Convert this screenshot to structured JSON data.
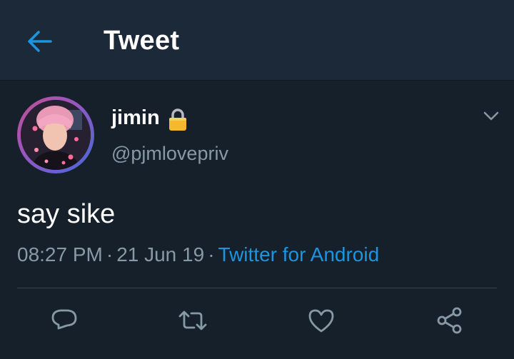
{
  "header": {
    "title": "Tweet",
    "back_icon": "arrow-left-icon"
  },
  "tweet": {
    "author": {
      "display_name": "jimin",
      "handle": "@pjmlovepriv",
      "protected_icon": "lock-icon"
    },
    "text": "say sike",
    "time": "08:27 PM",
    "date": "21 Jun 19",
    "separator": "·",
    "source": "Twitter for Android",
    "menu_icon": "chevron-down-icon",
    "actions": [
      "reply-icon",
      "retweet-icon",
      "like-icon",
      "share-icon"
    ]
  },
  "colors": {
    "background": "#16202b",
    "header": "#1c2938",
    "accent": "#1b95e0",
    "muted": "#8899a6",
    "divider": "#38444d"
  }
}
